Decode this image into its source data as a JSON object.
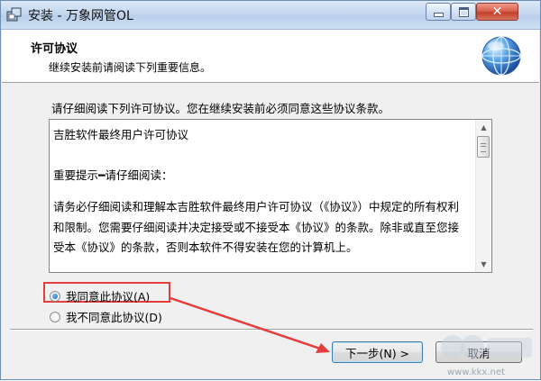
{
  "window": {
    "title": "安装 - 万象网管OL",
    "controls": [
      "minimize-icon",
      "maximize-icon",
      "close-icon"
    ]
  },
  "header": {
    "title": "许可协议",
    "subtitle": "继续安装前请阅读下列重要信息。",
    "icon": "globe-icon"
  },
  "intro": "请仔细阅读下列许可协议。您在继续安装前必须同意这些协议条款。",
  "license": {
    "paragraphs": [
      "吉胜软件最终用户许可协议",
      "重要提示━请仔细阅读：",
      "请务必仔细阅读和理解本吉胜软件最终用户许可协议（《协议》）中规定的所有权利和限制。您需要仔细阅读并决定接受或不接受本《协议》的条款。除非或直至您接受本《协议》的条款，否则本软件不得安装在您的计算机上。"
    ]
  },
  "options": [
    {
      "label": "我同意此协议(A)",
      "selected": true
    },
    {
      "label": "我不同意此协议(D)",
      "selected": false
    }
  ],
  "buttons": {
    "next": "下一步(N) >",
    "cancel": "取消"
  },
  "watermark": {
    "text": "www.kkx.net",
    "logo_text": "KK下载"
  },
  "colors": {
    "annotation": "#e53c3c",
    "title_bar": "#c4d7ef",
    "accent": "#3c7fb1"
  }
}
